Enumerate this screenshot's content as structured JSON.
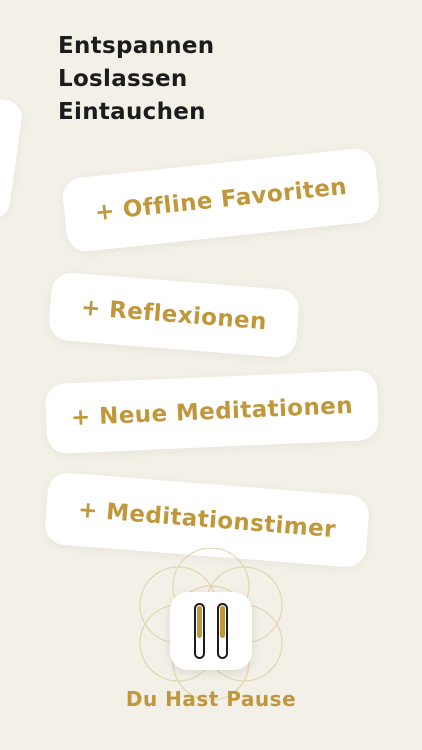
{
  "headline": {
    "lines": [
      "Entspannen",
      "Loslassen",
      "Eintauchen"
    ]
  },
  "features": [
    {
      "label": "+ Offline Favoriten"
    },
    {
      "label": "+ Reflexionen"
    },
    {
      "label": "+ Neue Meditationen"
    },
    {
      "label": "+ Meditationstimer"
    }
  ],
  "app": {
    "name": "Du Hast Pause",
    "icon": "pause-icon"
  },
  "colors": {
    "accent": "#c0973a",
    "background": "#f3f0e8",
    "text": "#1c1c1c",
    "card": "#ffffff"
  }
}
